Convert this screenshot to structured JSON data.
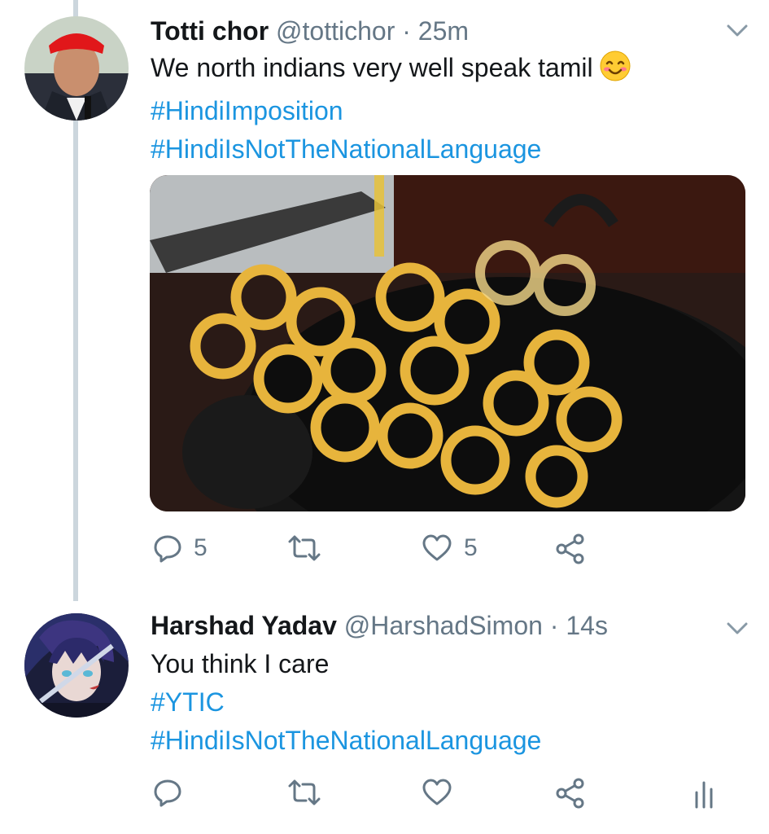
{
  "tweets": [
    {
      "display_name": "Totti chor",
      "handle": "@tottichor",
      "time": "25m",
      "text": "We north indians very well speak tamil",
      "emoji": "smiling-face-icon",
      "hashtags": [
        "#HindiImposition",
        "#HindiIsNotTheNationalLanguage"
      ],
      "media": "jalebi-frying-in-kadai-photo",
      "reply_count": "5",
      "retweet_count": "",
      "like_count": "5"
    },
    {
      "display_name": "Harshad Yadav",
      "handle": "@HarshadSimon",
      "time": "14s",
      "text": "You think I care",
      "hashtags": [
        "#YTIC",
        "#HindiIsNotTheNationalLanguage"
      ],
      "reply_count": "",
      "retweet_count": "",
      "like_count": ""
    }
  ],
  "separator": "·",
  "colors": {
    "link": "#1b95e0",
    "muted": "#657786",
    "thread": "#ccd6dd"
  }
}
